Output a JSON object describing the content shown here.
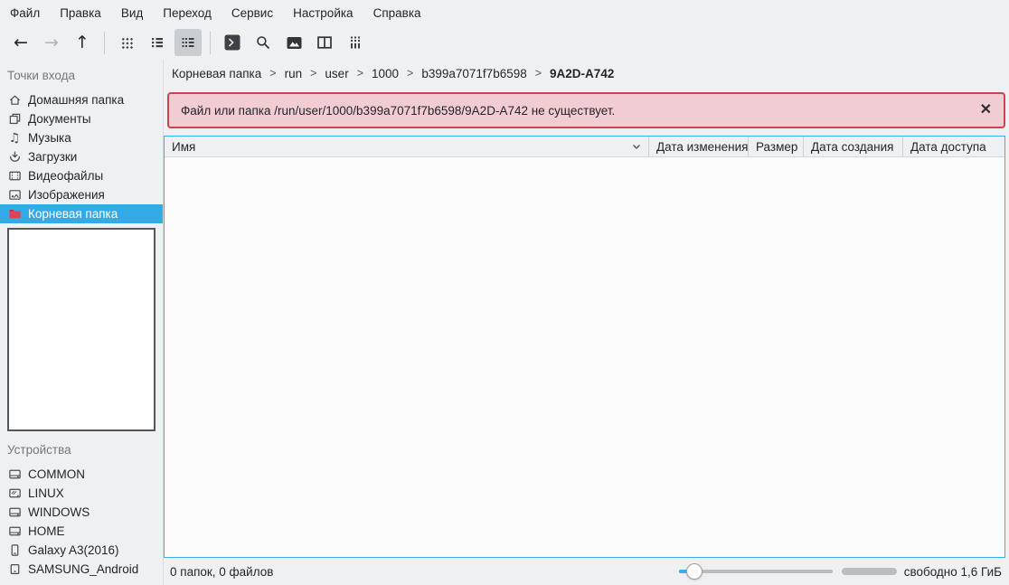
{
  "menubar": {
    "items": [
      "Файл",
      "Правка",
      "Вид",
      "Переход",
      "Сервис",
      "Настройка",
      "Справка"
    ]
  },
  "toolbar": {
    "back_icon": "←",
    "forward_icon": "→",
    "up_icon": "↑",
    "buttons": [
      "back",
      "forward",
      "up",
      "icons-view",
      "compact-view",
      "details-view",
      "open-terminal",
      "search",
      "show-preview",
      "split-view",
      "details-panel"
    ],
    "selected_button": "details-view"
  },
  "sidebar": {
    "places_label": "Точки входа",
    "places": [
      {
        "label": "Домашняя папка",
        "icon": "home-icon"
      },
      {
        "label": "Документы",
        "icon": "documents-icon"
      },
      {
        "label": "Музыка",
        "icon": "music-icon"
      },
      {
        "label": "Загрузки",
        "icon": "downloads-icon"
      },
      {
        "label": "Видеофайлы",
        "icon": "video-icon"
      },
      {
        "label": "Изображения",
        "icon": "images-icon"
      },
      {
        "label": "Корневая папка",
        "icon": "folder-red-icon",
        "selected": true
      }
    ],
    "devices_label": "Устройства",
    "devices": [
      {
        "label": "COMMON",
        "icon": "drive-icon"
      },
      {
        "label": "LINUX",
        "icon": "drive-linux-icon"
      },
      {
        "label": "WINDOWS",
        "icon": "drive-icon"
      },
      {
        "label": "HOME",
        "icon": "drive-icon"
      },
      {
        "label": "Galaxy A3(2016)",
        "icon": "phone-icon"
      },
      {
        "label": "SAMSUNG_Android",
        "icon": "media-player-icon"
      }
    ],
    "music_glyph": "♫"
  },
  "breadcrumb": {
    "items": [
      "Корневая папка",
      "run",
      "user",
      "1000",
      "b399a7071f7b6598",
      "9A2D-A742"
    ],
    "separator": ">"
  },
  "error_banner": {
    "message": "Файл или папка /run/user/1000/b399a7071f7b6598/9A2D-A742 не существует.",
    "close_icon": "✕"
  },
  "table": {
    "columns": [
      "Имя",
      "Дата изменения",
      "Размер",
      "Дата создания",
      "Дата доступа"
    ],
    "sort_column": "Имя",
    "sort_icon": "chevron-down"
  },
  "statusbar": {
    "summary": "0 папок, 0 файлов",
    "free_space": "свободно 1,6 ГиБ",
    "zoom_slider_percent": 8
  },
  "colors": {
    "selection": "#33a9e8",
    "view_border": "#3daee9",
    "error_border": "#cd4351",
    "error_bg": "#f2ccd3",
    "window_bg": "#eff0f1",
    "view_bg": "#fcfcfc",
    "folder_red": "#dd4455"
  }
}
